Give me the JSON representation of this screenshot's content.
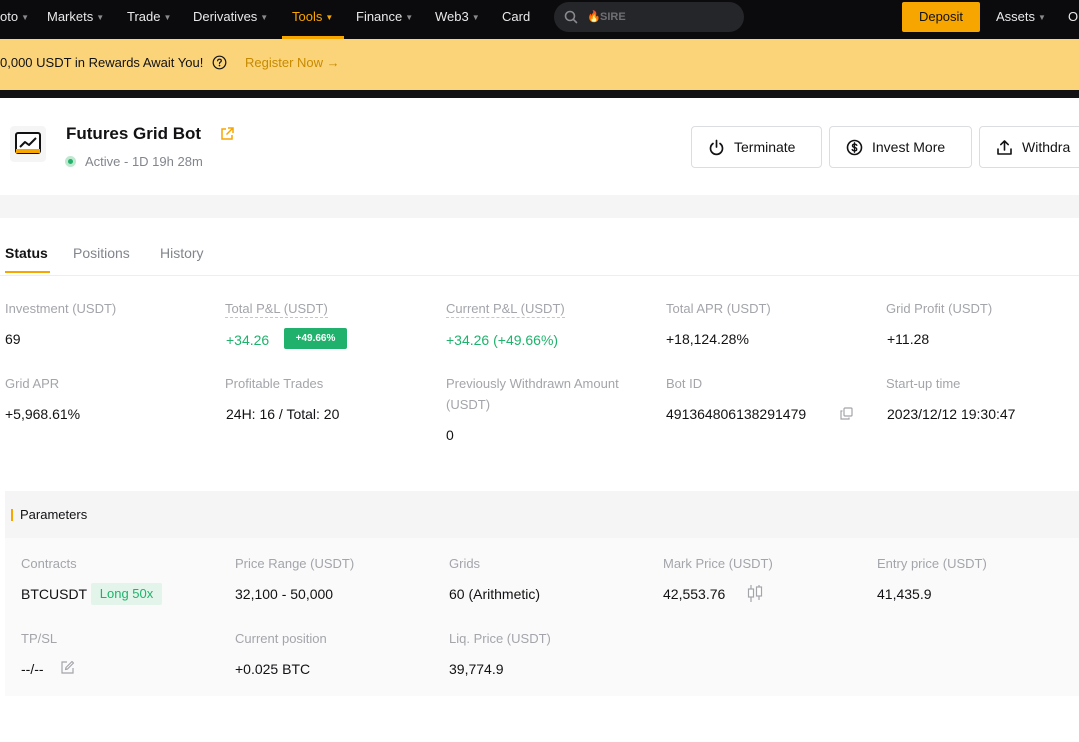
{
  "nav": {
    "items": [
      {
        "label": "oto",
        "caret": "▼"
      },
      {
        "label": "Markets",
        "caret": "▼"
      },
      {
        "label": "Trade",
        "caret": "▼"
      },
      {
        "label": "Derivatives",
        "caret": "▼"
      },
      {
        "label": "Tools",
        "caret": "▼"
      },
      {
        "label": "Finance",
        "caret": "▼"
      },
      {
        "label": "Web3",
        "caret": "▼"
      },
      {
        "label": "Card",
        "caret": ""
      }
    ],
    "active": "Tools",
    "search_text": "SIRE",
    "deposit_label": "Deposit",
    "assets": {
      "label": "Assets",
      "caret": "▼"
    },
    "orders_label": "O"
  },
  "banner": {
    "text": "0,000 USDT in Rewards Await You!",
    "link": "Register Now →",
    "bg_color": "#fbd47a"
  },
  "bot": {
    "title": "Futures Grid Bot",
    "status": "Active - 1D 19h 28m",
    "status_color": "#20b26c",
    "actions": {
      "terminate": "Terminate",
      "invest_more": "Invest More",
      "withdraw": "Withdra"
    }
  },
  "tabs": [
    "Status",
    "Positions",
    "History"
  ],
  "stats": {
    "investment": {
      "label": "Investment (USDT)",
      "value": "69"
    },
    "total_pnl": {
      "label": "Total P&L (USDT)",
      "value": "+34.26",
      "badge": "+49.66%"
    },
    "current_pnl": {
      "label": "Current P&L (USDT)",
      "value": "+34.26 (+49.66%)"
    },
    "total_apr": {
      "label": "Total APR (USDT)",
      "value": "+18,124.28%"
    },
    "grid_profit": {
      "label": "Grid Profit (USDT)",
      "value": "+11.28"
    },
    "grid_apr": {
      "label": "Grid APR",
      "value": "+5,968.61%"
    },
    "profitable_trades": {
      "label": "Profitable Trades",
      "value": "24H: 16 / Total: 20"
    },
    "prev_withdrawn": {
      "label_line1": "Previously Withdrawn Amount",
      "label_line2": "(USDT)",
      "value": "0"
    },
    "bot_id": {
      "label": "Bot ID",
      "value": "491364806138291479"
    },
    "startup_time": {
      "label": "Start-up time",
      "value": "2023/12/12 19:30:47"
    }
  },
  "parameters": {
    "title": "Parameters",
    "contracts": {
      "label": "Contracts",
      "value": "BTCUSDT",
      "badge": "Long 50x"
    },
    "price_range": {
      "label": "Price Range (USDT)",
      "value": "32,100 - 50,000"
    },
    "grids": {
      "label": "Grids",
      "value": "60 (Arithmetic)"
    },
    "mark_price": {
      "label": "Mark Price (USDT)",
      "value": "42,553.76"
    },
    "entry_price": {
      "label": "Entry price (USDT)",
      "value": "41,435.9"
    },
    "tpsl": {
      "label": "TP/SL",
      "value": "--/--"
    },
    "current_position": {
      "label": "Current position",
      "value": "+0.025 BTC"
    },
    "liq_price": {
      "label": "Liq. Price (USDT)",
      "value": "39,774.9"
    }
  },
  "icons": {
    "accent": "#f7a600",
    "profit_green": "#20b26c"
  }
}
